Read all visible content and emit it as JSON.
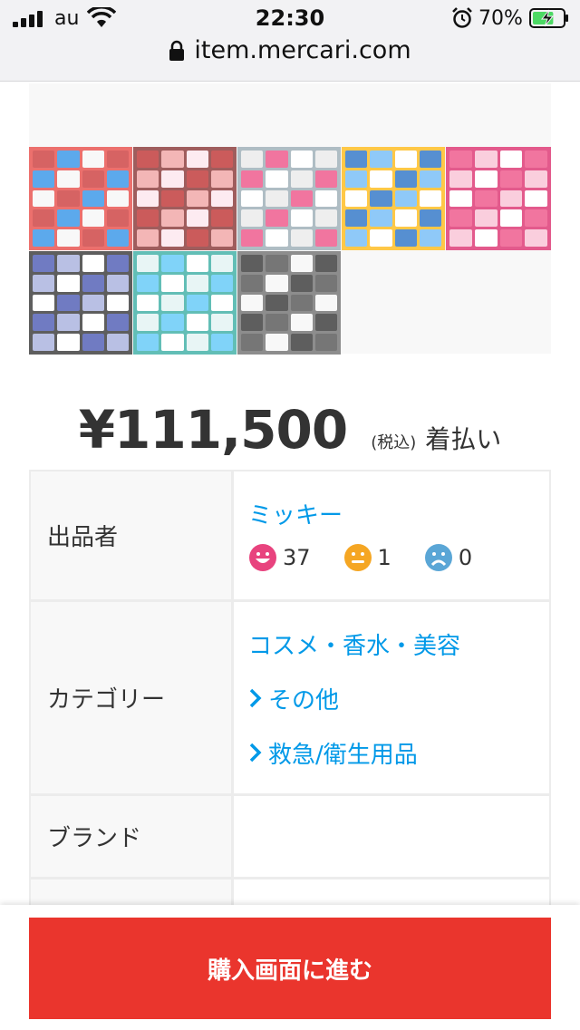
{
  "status_bar": {
    "carrier": "au",
    "time": "22:30",
    "battery_percent": "70%",
    "battery_level": 0.7
  },
  "browser": {
    "url": "item.mercari.com"
  },
  "gallery": {
    "thumbnails": [
      {
        "name": "mask-boxes-photo-1",
        "colors": [
          "#c62828",
          "#1e88e5",
          "#f5f5f5",
          "#e53935"
        ]
      },
      {
        "name": "mask-boxes-photo-2",
        "colors": [
          "#b71c1c",
          "#ef9a9a",
          "#fce4ec",
          "#7b1f1f"
        ]
      },
      {
        "name": "mask-boxes-photo-3",
        "colors": [
          "#e8e8e8",
          "#ec407a",
          "#ffffff",
          "#90a4ae"
        ]
      },
      {
        "name": "mask-boxes-photo-4",
        "colors": [
          "#1565c0",
          "#64b5f6",
          "#ffffff",
          "#ffb300"
        ]
      },
      {
        "name": "mask-boxes-photo-5",
        "colors": [
          "#ec407a",
          "#f8bbd0",
          "#ffffff",
          "#d81b60"
        ]
      },
      {
        "name": "mask-boxes-photo-6",
        "colors": [
          "#3949ab",
          "#9fa8da",
          "#ffffff",
          "#212121"
        ]
      },
      {
        "name": "mask-boxes-photo-7",
        "colors": [
          "#e0f2f1",
          "#4fc3f7",
          "#ffffff",
          "#26a69a"
        ]
      },
      {
        "name": "mask-box-premium-photo",
        "colors": [
          "#212121",
          "#424242",
          "#f5f5f5",
          "#616161"
        ]
      }
    ]
  },
  "price": {
    "amount": "¥111,500",
    "tax_note": "(税込)",
    "shipping": "着払い"
  },
  "details": {
    "seller_label": "出品者",
    "seller_name": "ミッキー",
    "ratings": {
      "good": "37",
      "normal": "1",
      "bad": "0"
    },
    "category_label": "カテゴリー",
    "categories": [
      "コスメ・香水・美容",
      "その他",
      "救急/衛生用品"
    ],
    "brand_label": "ブランド",
    "brand_value": ""
  },
  "colors": {
    "accent_blue": "#0099e8",
    "buy_red": "#ea352d",
    "good": "#e8437e",
    "normal": "#f5a623",
    "bad": "#5aa6d6"
  },
  "actions": {
    "buy_label": "購入画面に進む"
  }
}
